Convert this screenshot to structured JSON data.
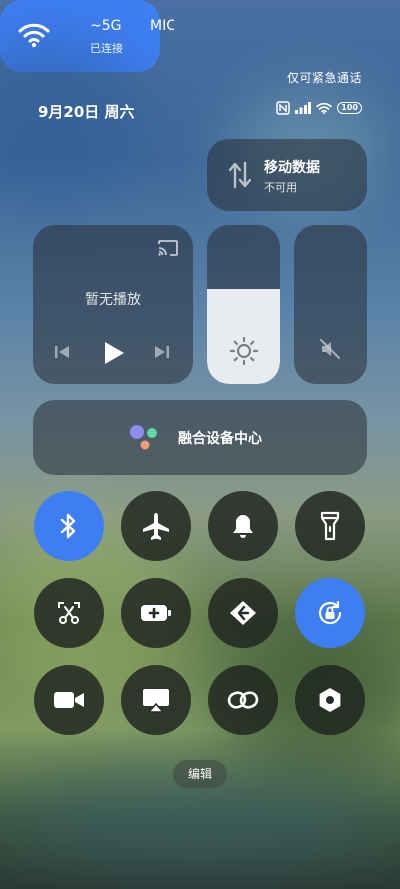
{
  "status_bar": {
    "carrier_status": "仅可紧急通话",
    "date": "9月20日 周六",
    "battery": "100"
  },
  "wifi_tile": {
    "network_1": "~5G",
    "network_2": "MIC",
    "status": "已连接",
    "active": true
  },
  "mobile_data_tile": {
    "title": "移动数据",
    "status": "不可用",
    "active": false
  },
  "media_tile": {
    "title": "暂无播放"
  },
  "brightness": {
    "level": 0.6
  },
  "fusion_tile": {
    "label": "融合设备中心"
  },
  "quick_toggles": [
    {
      "name": "bluetooth",
      "active": true
    },
    {
      "name": "airplane-mode",
      "active": false
    },
    {
      "name": "sound",
      "active": false
    },
    {
      "name": "flashlight",
      "active": false
    },
    {
      "name": "screenshot",
      "active": false
    },
    {
      "name": "battery-saver",
      "active": false
    },
    {
      "name": "connect-share",
      "active": false
    },
    {
      "name": "rotation-lock",
      "active": true
    },
    {
      "name": "screen-record",
      "active": false
    },
    {
      "name": "screen-cast",
      "active": false
    },
    {
      "name": "link",
      "active": false
    },
    {
      "name": "settings-nut",
      "active": false
    }
  ],
  "edit_button": {
    "label": "编辑"
  },
  "colors": {
    "accent": "#3e7ef2",
    "tile_dark": "#282d37"
  }
}
